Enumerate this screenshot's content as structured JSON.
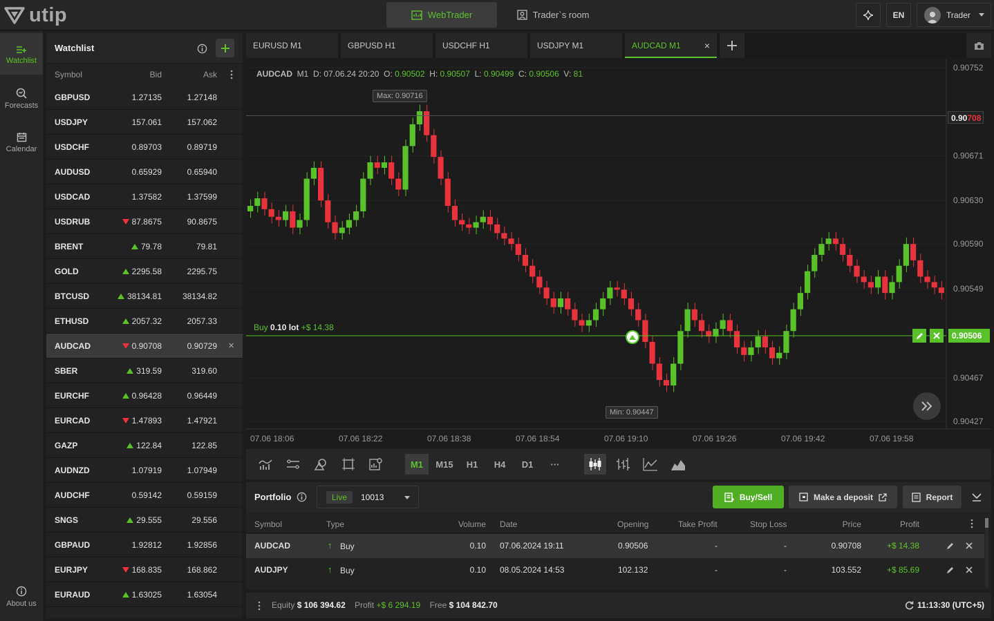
{
  "app": {
    "logo": "utip"
  },
  "topbar": {
    "webtrader": "WebTrader",
    "traders_room": "Trader`s room",
    "language": "EN",
    "user": "Trader"
  },
  "nav": [
    {
      "label": "Watchlist",
      "icon": "watchlist-icon",
      "active": true
    },
    {
      "label": "Forecasts",
      "icon": "forecasts-icon"
    },
    {
      "label": "Calendar",
      "icon": "calendar-icon"
    },
    {
      "label": "About us",
      "icon": "info-icon"
    }
  ],
  "watchlist": {
    "title": "Watchlist",
    "columns": [
      "Symbol",
      "Bid",
      "Ask"
    ],
    "rows": [
      {
        "symbol": "GBPUSD",
        "bid": "1.27135",
        "ask": "1.27148",
        "trend": ""
      },
      {
        "symbol": "USDJPY",
        "bid": "157.061",
        "ask": "157.062",
        "trend": ""
      },
      {
        "symbol": "USDCHF",
        "bid": "0.89703",
        "ask": "0.89719",
        "trend": ""
      },
      {
        "symbol": "AUDUSD",
        "bid": "0.65929",
        "ask": "0.65940",
        "trend": ""
      },
      {
        "symbol": "USDCAD",
        "bid": "1.37582",
        "ask": "1.37599",
        "trend": ""
      },
      {
        "symbol": "USDRUB",
        "bid": "87.8675",
        "ask": "90.8675",
        "trend": "down"
      },
      {
        "symbol": "BRENT",
        "bid": "79.78",
        "ask": "79.81",
        "trend": "up"
      },
      {
        "symbol": "GOLD",
        "bid": "2295.58",
        "ask": "2295.75",
        "trend": "up"
      },
      {
        "symbol": "BTCUSD",
        "bid": "38134.81",
        "ask": "38134.82",
        "trend": "up"
      },
      {
        "symbol": "ETHUSD",
        "bid": "2057.32",
        "ask": "2057.33",
        "trend": "up"
      },
      {
        "symbol": "AUDCAD",
        "bid": "0.90708",
        "ask": "0.90729",
        "trend": "down",
        "selected": true
      },
      {
        "symbol": "SBER",
        "bid": "319.59",
        "ask": "319.60",
        "trend": "up"
      },
      {
        "symbol": "EURCHF",
        "bid": "0.96428",
        "ask": "0.96449",
        "trend": "up"
      },
      {
        "symbol": "EURCAD",
        "bid": "1.47893",
        "ask": "1.47921",
        "trend": "down"
      },
      {
        "symbol": "GAZP",
        "bid": "122.84",
        "ask": "122.85",
        "trend": "up"
      },
      {
        "symbol": "AUDNZD",
        "bid": "1.07919",
        "ask": "1.07949",
        "trend": ""
      },
      {
        "symbol": "AUDCHF",
        "bid": "0.59142",
        "ask": "0.59159",
        "trend": ""
      },
      {
        "symbol": "SNGS",
        "bid": "29.555",
        "ask": "29.556",
        "trend": "up"
      },
      {
        "symbol": "GBPAUD",
        "bid": "1.92812",
        "ask": "1.92856",
        "trend": ""
      },
      {
        "symbol": "EURJPY",
        "bid": "168.835",
        "ask": "168.862",
        "trend": "down"
      },
      {
        "symbol": "EURAUD",
        "bid": "1.63025",
        "ask": "1.63054",
        "trend": "up"
      }
    ]
  },
  "tabs": [
    {
      "label": "EURUSD M1"
    },
    {
      "label": "GBPUSD H1"
    },
    {
      "label": "USDCHF H1"
    },
    {
      "label": "USDJPY M1"
    },
    {
      "label": "AUDCAD M1",
      "active": true
    }
  ],
  "chart": {
    "symbol": "AUDCAD",
    "tf": "M1",
    "d_label": "D:",
    "date": "07.06.24 20:20",
    "o_label": "O:",
    "open": "0.90502",
    "h_label": "H:",
    "high": "0.90507",
    "l_label": "L:",
    "low": "0.90499",
    "c_label": "C:",
    "close": "0.90506",
    "v_label": "V:",
    "volume": "81",
    "max_label": "Max: 0.90716",
    "min_label": "Min: 0.90447",
    "price_now_main": "0.90",
    "price_now_tail": "708",
    "position_price": "0.90506",
    "position_label": "Buy",
    "position_lot": "0.10 lot",
    "position_profit": "+$ 14.38",
    "y_ticks": [
      "0.90752",
      "0.90671",
      "0.90630",
      "0.90590",
      "0.90549",
      "0.90467",
      "0.90427"
    ],
    "x_ticks": [
      "07.06 18:06",
      "07.06 18:22",
      "07.06 18:38",
      "07.06 18:54",
      "07.06 19:10",
      "07.06 19:26",
      "07.06 19:42",
      "07.06 19:58"
    ],
    "colors": {
      "up": "#59c22a",
      "down": "#e8323c"
    }
  },
  "chart_data": {
    "type": "candlestick",
    "x": "time (07.06.24, 18:00–20:20)",
    "ylim": [
      0.90427,
      0.90752
    ],
    "closes": [
      0.90625,
      0.90632,
      0.90622,
      0.90615,
      0.90612,
      0.9062,
      0.90605,
      0.90612,
      0.9065,
      0.9066,
      0.9063,
      0.9061,
      0.906,
      0.90605,
      0.90612,
      0.9062,
      0.9065,
      0.90665,
      0.9066,
      0.90665,
      0.9065,
      0.9064,
      0.9068,
      0.907,
      0.90712,
      0.9069,
      0.9067,
      0.9065,
      0.90625,
      0.90612,
      0.90608,
      0.90605,
      0.9061,
      0.90615,
      0.90608,
      0.906,
      0.90595,
      0.9059,
      0.9058,
      0.9057,
      0.9056,
      0.9055,
      0.9054,
      0.90532,
      0.9054,
      0.9053,
      0.9052,
      0.90515,
      0.9052,
      0.9053,
      0.9054,
      0.9055,
      0.90548,
      0.9054,
      0.9053,
      0.9052,
      0.905,
      0.9048,
      0.90465,
      0.9046,
      0.9048,
      0.9051,
      0.9053,
      0.9052,
      0.9051,
      0.90505,
      0.90512,
      0.9052,
      0.9051,
      0.90495,
      0.90488,
      0.90495,
      0.90505,
      0.90495,
      0.90485,
      0.9049,
      0.9051,
      0.9053,
      0.90545,
      0.90565,
      0.9058,
      0.9059,
      0.90595,
      0.9059,
      0.9058,
      0.9057,
      0.9056,
      0.90555,
      0.9055,
      0.9056,
      0.90545,
      0.90555,
      0.9057,
      0.9059,
      0.90575,
      0.9056,
      0.90555,
      0.9055,
      0.90545
    ]
  },
  "toolbar": {
    "timeframes": [
      "M1",
      "M15",
      "H1",
      "H4",
      "D1"
    ],
    "more": "···",
    "active_tf": "M1"
  },
  "portfolio": {
    "title": "Portfolio",
    "account_type": "Live",
    "account_id": "10013",
    "buy_sell": "Buy/Sell",
    "deposit": "Make a deposit",
    "report": "Report",
    "columns": [
      "Symbol",
      "Type",
      "Volume",
      "Date",
      "Opening",
      "Take Profit",
      "Stop Loss",
      "Price",
      "Profit"
    ],
    "rows": [
      {
        "symbol": "AUDCAD",
        "type": "Buy",
        "volume": "0.10",
        "date": "07.06.2024 19:11",
        "opening": "0.90506",
        "tp": "-",
        "sl": "-",
        "price": "0.90708",
        "profit": "+$ 14.38"
      },
      {
        "symbol": "AUDJPY",
        "type": "Buy",
        "volume": "0.10",
        "date": "08.05.2024 14:53",
        "opening": "102.132",
        "tp": "-",
        "sl": "-",
        "price": "103.552",
        "profit": "+$ 85.69"
      }
    ]
  },
  "footer": {
    "equity_label": "Equity",
    "equity": "$ 106 394.62",
    "profit_label": "Profit",
    "profit": "+$ 6 294.19",
    "free_label": "Free",
    "free": "$ 104 842.70",
    "time": "11:13:30 (UTC+5)"
  }
}
